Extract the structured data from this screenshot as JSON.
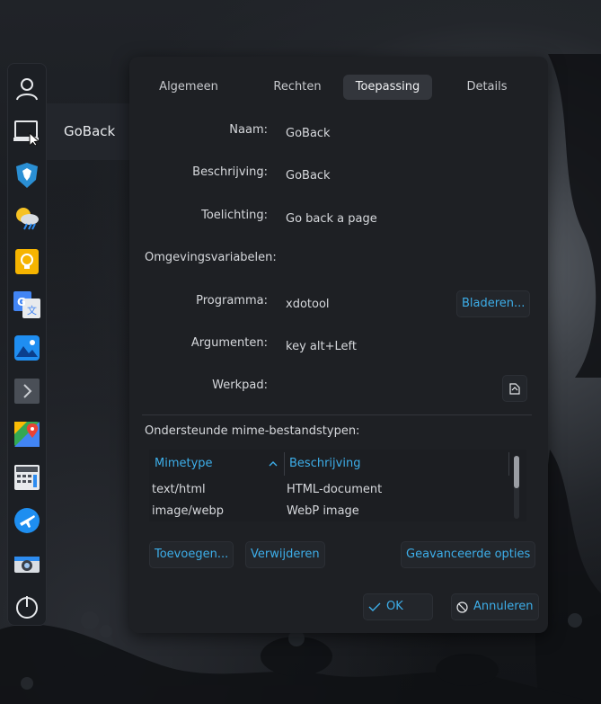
{
  "launcher": {
    "hover_label": "GoBack",
    "items": [
      {
        "name": "user-icon"
      },
      {
        "name": "goback-app-icon"
      },
      {
        "name": "brave-browser-icon"
      },
      {
        "name": "weather-icon"
      },
      {
        "name": "keep-notes-icon"
      },
      {
        "name": "google-translate-icon"
      },
      {
        "name": "image-viewer-icon"
      },
      {
        "name": "terminal-icon"
      },
      {
        "name": "google-maps-icon"
      },
      {
        "name": "calculator-icon"
      },
      {
        "name": "flight-app-icon"
      },
      {
        "name": "camera-icon"
      },
      {
        "name": "power-icon"
      }
    ]
  },
  "dialog": {
    "tabs": [
      {
        "label": "Algemeen"
      },
      {
        "label": "Rechten"
      },
      {
        "label": "Toepassing",
        "active": true
      },
      {
        "label": "Details"
      }
    ],
    "fields": {
      "name_label": "Naam:",
      "name_value": "GoBack",
      "description_label": "Beschrijving:",
      "description_value": "GoBack",
      "comment_label": "Toelichting:",
      "comment_value": "Go back a page",
      "env_label": "Omgevingsvariabelen:",
      "program_label": "Programma:",
      "program_value": "xdotool",
      "browse_button": "Bladeren...",
      "arguments_label": "Argumenten:",
      "arguments_value": "key alt+Left",
      "workdir_label": "Werkpad:"
    },
    "mime": {
      "section_label": "Ondersteunde mime-bestandstypen:",
      "columns": [
        "Mimetype",
        "Beschrijving"
      ],
      "rows": [
        [
          "text/html",
          "HTML-document"
        ],
        [
          "image/webp",
          "WebP image"
        ]
      ],
      "add_button": "Toevoegen...",
      "remove_button": "Verwijderen",
      "advanced_button": "Geavanceerde opties"
    },
    "ok_button": "OK",
    "cancel_button": "Annuleren"
  },
  "colors": {
    "accent": "#3daee9",
    "dialog_bg": "#1e2024",
    "text": "#d6d8dc"
  }
}
